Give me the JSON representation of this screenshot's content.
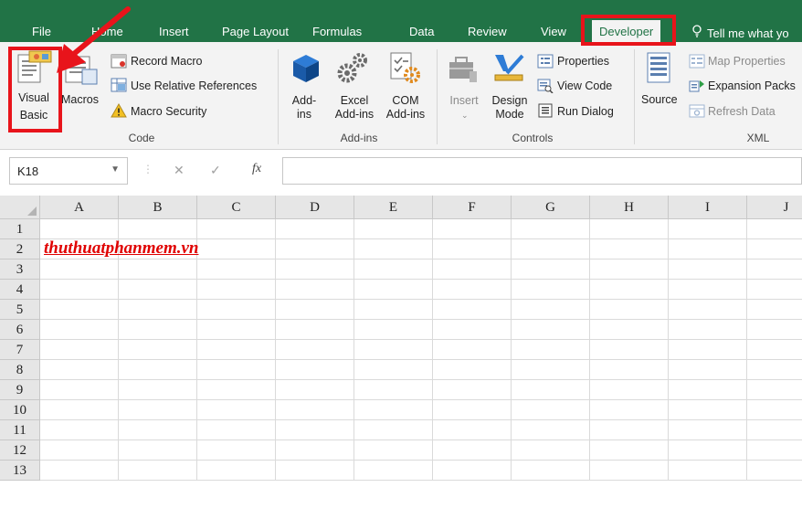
{
  "tabs": [
    {
      "label": "File"
    },
    {
      "label": "Home"
    },
    {
      "label": "Insert"
    },
    {
      "label": "Page Layout"
    },
    {
      "label": "Formulas"
    },
    {
      "label": "Data"
    },
    {
      "label": "Review"
    },
    {
      "label": "View"
    },
    {
      "label": "Developer"
    }
  ],
  "tell_me": "Tell me what yo",
  "groups": {
    "code": {
      "label": "Code",
      "visual_basic": [
        "Visual",
        "Basic"
      ],
      "macros": "Macros",
      "record_macro": "Record Macro",
      "use_relative": "Use Relative References",
      "macro_security": "Macro Security"
    },
    "addins": {
      "label": "Add-ins",
      "addins": [
        "Add-",
        "ins"
      ],
      "excel_addins": [
        "Excel",
        "Add-ins"
      ],
      "com_addins": [
        "COM",
        "Add-ins"
      ]
    },
    "controls": {
      "label": "Controls",
      "insert": "Insert",
      "design_mode": [
        "Design",
        "Mode"
      ],
      "properties": "Properties",
      "view_code": "View Code",
      "run_dialog": "Run Dialog"
    },
    "xml": {
      "label": "XML",
      "source": "Source",
      "map_properties": "Map Properties",
      "expansion_packs": "Expansion Packs",
      "refresh_data": "Refresh Data"
    }
  },
  "formula_bar": {
    "name_box": "K18",
    "fx": "fx",
    "cancel": "✕",
    "enter": "✓",
    "value": ""
  },
  "sheet": {
    "columns": [
      "A",
      "B",
      "C",
      "D",
      "E",
      "F",
      "G",
      "H",
      "I",
      "J"
    ],
    "rows": [
      "1",
      "2",
      "3",
      "4",
      "5",
      "6",
      "7",
      "8",
      "9",
      "10",
      "11",
      "12",
      "13"
    ],
    "cell_a2": "thuthuatphanmem.vn"
  },
  "colors": {
    "ribbon_green": "#217346",
    "highlight_red": "#e8141b",
    "cell_text_red": "#e00000"
  }
}
